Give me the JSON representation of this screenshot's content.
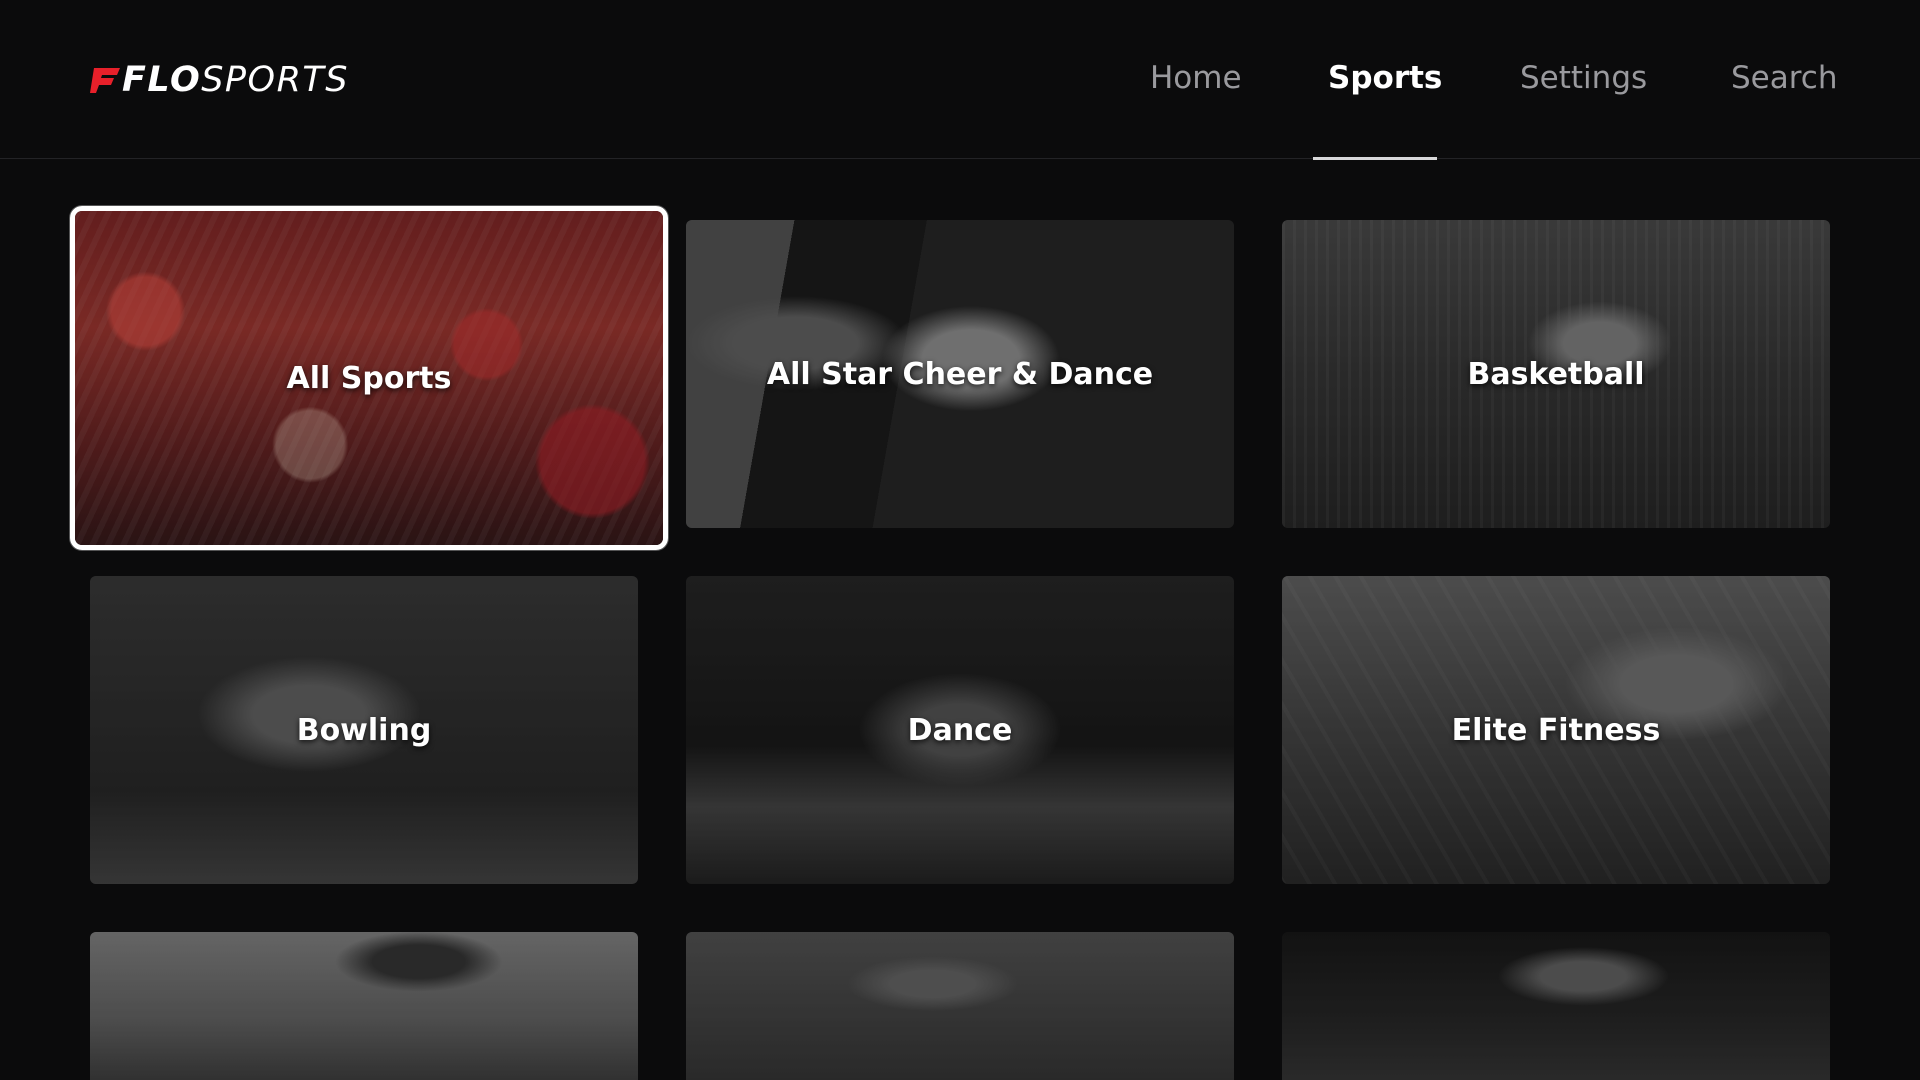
{
  "brand": {
    "logo_text_flo": "FLO",
    "logo_text_sports": "SPORTS",
    "accent_color": "#e8202a"
  },
  "nav": {
    "items": [
      {
        "label": "Home",
        "active": false
      },
      {
        "label": "Sports",
        "active": true
      },
      {
        "label": "Settings",
        "active": false
      },
      {
        "label": "Search",
        "active": false
      }
    ]
  },
  "tiles": [
    {
      "label": "All Sports",
      "focused": true,
      "image": "crowd-photo"
    },
    {
      "label": "All Star Cheer & Dance",
      "focused": false,
      "image": "cheer-photo"
    },
    {
      "label": "Basketball",
      "focused": false,
      "image": "basketball-photo"
    },
    {
      "label": "Bowling",
      "focused": false,
      "image": "bowling-photo"
    },
    {
      "label": "Dance",
      "focused": false,
      "image": "dance-photo"
    },
    {
      "label": "Elite Fitness",
      "focused": false,
      "image": "weightlifting-photo"
    },
    {
      "label": "",
      "focused": false,
      "image": "camera-photo"
    },
    {
      "label": "",
      "focused": false,
      "image": "football-photo"
    },
    {
      "label": "",
      "focused": false,
      "image": "gymnastics-photo"
    }
  ]
}
